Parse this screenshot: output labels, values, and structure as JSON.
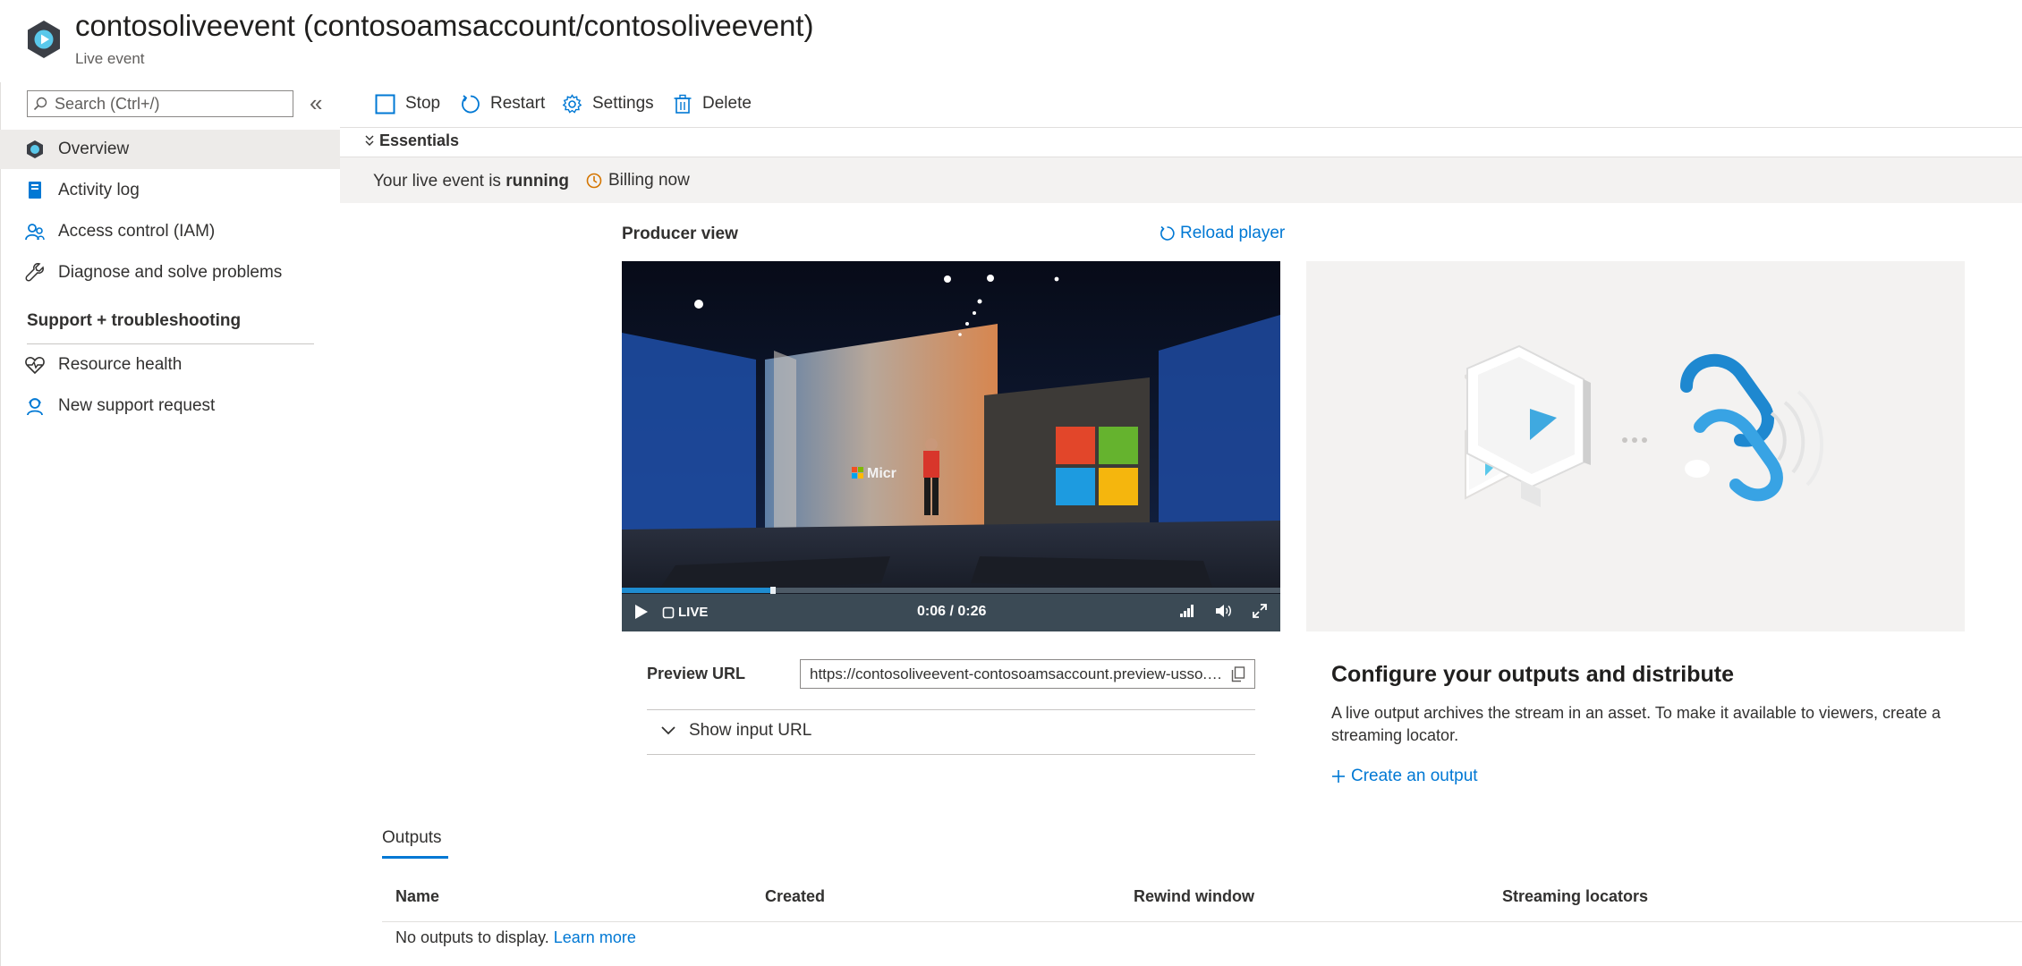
{
  "header": {
    "title": "contosoliveevent (contosoamsaccount/contosoliveevent)",
    "subtitle": "Live event",
    "icon": "live-event-icon"
  },
  "sidebar": {
    "search_placeholder": "Search (Ctrl+/)",
    "collapse_glyph": "«",
    "items": [
      {
        "label": "Overview",
        "icon": "overview-icon",
        "selected": true
      },
      {
        "label": "Activity log",
        "icon": "activity-log-icon"
      },
      {
        "label": "Access control (IAM)",
        "icon": "access-control-icon"
      },
      {
        "label": "Diagnose and solve problems",
        "icon": "wrench-icon"
      }
    ],
    "section_title": "Support + troubleshooting",
    "support_items": [
      {
        "label": "Resource health",
        "icon": "heart-pulse-icon"
      },
      {
        "label": "New support request",
        "icon": "support-person-icon"
      }
    ]
  },
  "toolbar": {
    "stop": "Stop",
    "restart": "Restart",
    "settings": "Settings",
    "delete": "Delete"
  },
  "essentials": {
    "label": "Essentials",
    "status_prefix": "Your live event is",
    "status_value": "running",
    "billing": "Billing now"
  },
  "producer": {
    "title": "Producer view",
    "reload": "Reload player",
    "live_label": "LIVE",
    "time": "0:06 / 0:26",
    "progress": 0.23,
    "stage_sign": "Micr",
    "preview_label": "Preview URL",
    "preview_url": "https://contosoliveevent-contosoamsaccount.preview-usso.channel.media.azure.net/",
    "show_input": "Show input URL"
  },
  "config": {
    "title": "Configure your outputs and distribute",
    "description": "A live output archives the stream in an asset. To make it available to viewers, create a streaming locator.",
    "create": "Create an output"
  },
  "outputs": {
    "tab": "Outputs",
    "columns": [
      "Name",
      "Created",
      "Rewind window",
      "Streaming locators"
    ],
    "empty": "No outputs to display.",
    "learn_more": "Learn more"
  },
  "colors": {
    "accent": "#0078d4",
    "billing": "#d47500",
    "selected_bg": "#edebe9"
  }
}
